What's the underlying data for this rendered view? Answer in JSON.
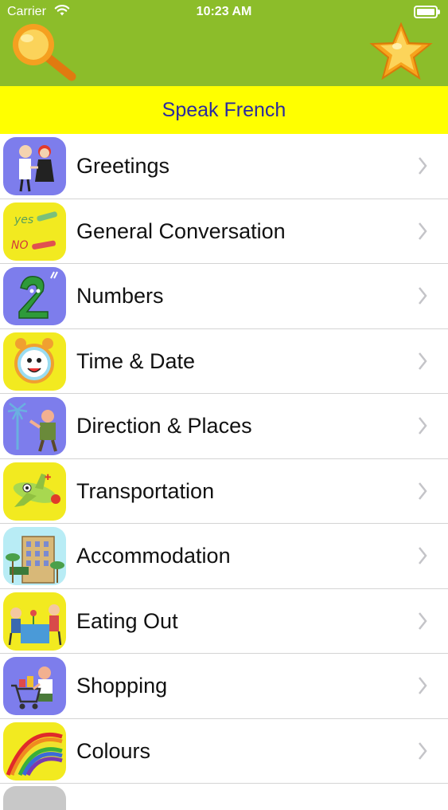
{
  "status_bar": {
    "carrier": "Carrier",
    "time": "10:23 AM"
  },
  "header": {
    "search_icon": "magnifier-icon",
    "favorites_icon": "star-icon",
    "title": "Speak French",
    "colors": {
      "top_bar": "#8cbd2a",
      "title_bar": "#ffff00",
      "title_text": "#2a2aa0"
    }
  },
  "categories": [
    {
      "label": "Greetings",
      "icon": "greetings-icon",
      "icon_bg": "#7d7dec"
    },
    {
      "label": "General Conversation",
      "icon": "yes-no-icon",
      "icon_bg": "#f2ea20"
    },
    {
      "label": "Numbers",
      "icon": "number-two-icon",
      "icon_bg": "#7d7dec"
    },
    {
      "label": "Time & Date",
      "icon": "alarm-clock-icon",
      "icon_bg": "#f2ea20"
    },
    {
      "label": "Direction & Places",
      "icon": "signpost-icon",
      "icon_bg": "#7d7dec"
    },
    {
      "label": "Transportation",
      "icon": "airplane-icon",
      "icon_bg": "#f2ea20"
    },
    {
      "label": "Accommodation",
      "icon": "hotel-icon",
      "icon_bg": "#b8ecf5"
    },
    {
      "label": "Eating Out",
      "icon": "dining-icon",
      "icon_bg": "#f2ea20"
    },
    {
      "label": "Shopping",
      "icon": "shopping-cart-icon",
      "icon_bg": "#7d7dec"
    },
    {
      "label": "Colours",
      "icon": "rainbow-icon",
      "icon_bg": "#f2ea20"
    }
  ]
}
